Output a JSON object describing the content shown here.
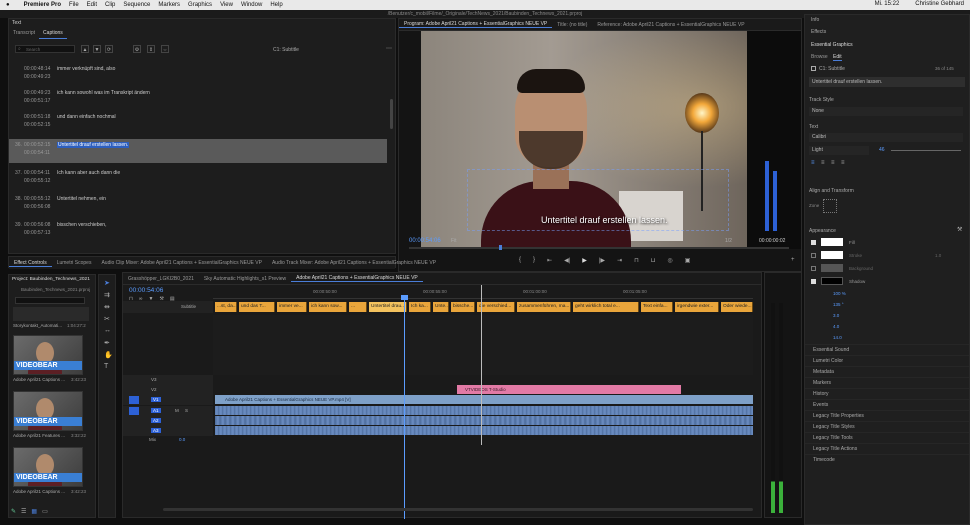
{
  "menubar": {
    "app": "Premiere Pro",
    "items": [
      "File",
      "Edit",
      "Clip",
      "Sequence",
      "Markers",
      "Graphics",
      "View",
      "Window",
      "Help"
    ],
    "clock": "Mi. 15:22",
    "user": "Christine Gebhard"
  },
  "titlebar": {
    "path": "/Benutzer/c_mobil/Filme/_Originale/TechNews_2021/Baubinden_Technews_2021.prproj"
  },
  "text_panel": {
    "title": "Text",
    "tabs": [
      "Transcript",
      "Captions"
    ],
    "search_placeholder": "Search",
    "track_name": "C1: Subtitle",
    "captions": [
      {
        "n": "",
        "start": "00:00:48:14",
        "end": "00:00:49:23",
        "text": "immer verknüpft sind, also"
      },
      {
        "n": "",
        "start": "00:00:49:23",
        "end": "00:00:51:17",
        "text": "ich kann sowohl was im Transkript ändern"
      },
      {
        "n": "",
        "start": "00:00:51:18",
        "end": "00:00:52:15",
        "text": "und dann einfach nochmal"
      },
      {
        "n": "36.",
        "start": "00:00:52:15",
        "end": "00:00:54:11",
        "text": "Untertitel drauf erstellen lassen."
      },
      {
        "n": "37.",
        "start": "00:00:54:11",
        "end": "00:00:55:12",
        "text": "Ich kann aber auch dann die"
      },
      {
        "n": "38.",
        "start": "00:00:55:12",
        "end": "00:00:56:08",
        "text": "Untertitel nehmen, ein"
      },
      {
        "n": "39.",
        "start": "00:00:56:08",
        "end": "00:00:57:13",
        "text": "bisschen verschieben,"
      }
    ]
  },
  "program_monitor": {
    "tabs": [
      "Program: Adobe April21 Captions + EssentialGraphics NEUE VP",
      "Title: (no title)",
      "Reference: Adobe April21 Captions + EssentialGraphics NEUE VP"
    ],
    "subtitle": "Untertitel drauf erstellen lassen.",
    "timecode": "00:00:54:06",
    "fit": "Fit",
    "ratio": "1/2",
    "duration": "00:00:00:02"
  },
  "right_panel": {
    "top_items": [
      "Info",
      "Effects"
    ],
    "essential_graphics": "Essential Graphics",
    "tabs": [
      "Browse",
      "Edit"
    ],
    "track": "C1: Subtitle",
    "count": "36 of 145",
    "caption_value": "Untertitel drauf erstellen lassen.",
    "track_style_label": "Track Style",
    "track_style": "None",
    "text_label": "Text",
    "font": "Calibri",
    "weight": "Light",
    "size": "46",
    "align_label": "Align and Transform",
    "zone": "Zone",
    "appearance": "Appearance",
    "fill": "Fill",
    "stroke": "Stroke",
    "background": "Background",
    "shadow": "Shadow",
    "stroke_val": "1.0",
    "shadow_vals": [
      "100 %",
      "135 °",
      "3.0",
      "4.0",
      "14.0"
    ],
    "bottom_items": [
      "Essential Sound",
      "Lumetri Color",
      "Metadata",
      "Markers",
      "History",
      "Events",
      "Legacy Title Properties",
      "Legacy Title Styles",
      "Legacy Title Tools",
      "Legacy Title Actions",
      "Timecode"
    ]
  },
  "effect_controls": {
    "tabs": [
      "Effect Controls",
      "Lumetri Scopes",
      "Audio Clip Mixer: Adobe April21 Captions + EssentialGraphics NEUE VP",
      "Audio Track Mixer: Adobe April21 Captions + EssentialGraphics NEUE VP"
    ]
  },
  "project_panel": {
    "title": "Project: Baubinden_Technews_2021",
    "file": "Baubinden_Technews_2021.prproj",
    "items": [
      {
        "name": "Storykontakt_Automati...",
        "dur": "1:04:27:2"
      },
      {
        "name": "Adobe April21 Captions ...",
        "dur": "3:42:23"
      },
      {
        "name": "Adobe April21 Features ...",
        "dur": "3:32:22"
      },
      {
        "name": "Adobe April21 Captions ...",
        "dur": "3:42:23"
      }
    ],
    "banner": "VIDEOBEAR"
  },
  "timeline": {
    "tabs": [
      "Grasshöpper_LGKI2B0_2021",
      "Sky Automatic Highlights_s1 Preview",
      "Adobe April21 Captions + EssentialGraphics NEUE VP"
    ],
    "timecode": "00:00:54:06",
    "ruler": [
      "00:00:50:00",
      "00:00:55:00",
      "00:01:00:00",
      "00:01:05:00"
    ],
    "subtitle_track": "Subtitle",
    "captions": [
      "...st, da...",
      "und das T...",
      "immer ve...",
      "ich kann sow...",
      "...",
      "Untertitel drau...",
      "Ich ka...",
      "Unte...",
      "bissche...",
      "die verschied...",
      "zusammenführen, ma...",
      "geht wirklich total e...",
      "Text einfa...",
      "irgendwie exter...",
      "Oder wiede..."
    ],
    "pink_clip": "VTVIDEOS T-Studio",
    "video_clip": "Adobe April21 Captions + EssentialGraphics NEUE VP.mp4 [V]",
    "tracks_v": [
      "V3",
      "V2",
      "V1"
    ],
    "tracks_a": [
      "A1",
      "A2",
      "A3"
    ],
    "mix": "Mix",
    "mix_val": "0.0"
  }
}
